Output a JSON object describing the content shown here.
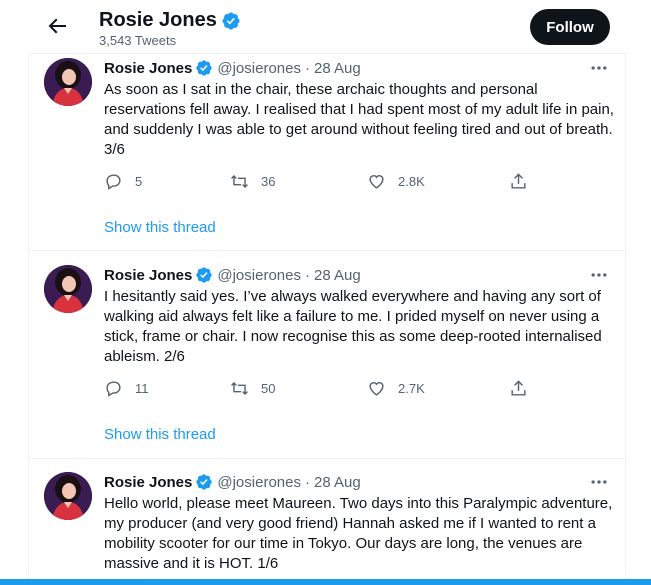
{
  "header": {
    "name": "Rosie Jones",
    "tweet_count": "3,543 Tweets",
    "follow_label": "Follow"
  },
  "tweets": [
    {
      "name": "Rosie Jones",
      "handle": "@josierones",
      "separator": "·",
      "date": "28 Aug",
      "text": "As soon as I sat in the chair, these archaic thoughts and personal reservations fell away. I realised that I had spent most of my adult life in pain, and suddenly I was able to get around without feeling tired and out of breath. 3/6",
      "replies": "5",
      "retweets": "36",
      "likes": "2.8K",
      "show_thread": "Show this thread"
    },
    {
      "name": "Rosie Jones",
      "handle": "@josierones",
      "separator": "·",
      "date": "28 Aug",
      "text": "I hesitantly said yes. I’ve always walked everywhere and having any sort of walking aid always felt like a failure to me. I prided myself on never using a stick, frame or chair. I now recognise this as some deep-rooted internalised ableism. 2/6",
      "replies": "11",
      "retweets": "50",
      "likes": "2.7K",
      "show_thread": "Show this thread"
    },
    {
      "name": "Rosie Jones",
      "handle": "@josierones",
      "separator": "·",
      "date": "28 Aug",
      "text": "Hello world, please meet Maureen. Two days into this Paralympic adventure, my producer (and very good friend) Hannah asked me if I wanted to rent a mobility scooter for our time in Tokyo. Our days are long, the venues are massive and it is HOT. 1/6"
    }
  ],
  "icons": {
    "back": "back-arrow-icon",
    "verified": "verified-badge-icon",
    "more": "more-icon",
    "reply": "reply-icon",
    "retweet": "retweet-icon",
    "like": "like-icon",
    "share": "share-icon"
  },
  "colors": {
    "accent": "#1d9bf0",
    "follow_bg": "#0f1419",
    "secondary_text": "#536471"
  }
}
